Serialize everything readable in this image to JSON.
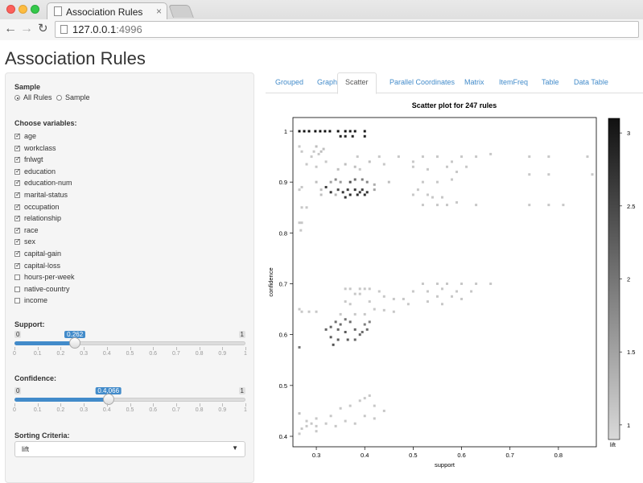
{
  "browser": {
    "tab_title": "Association Rules",
    "tab_close": "×",
    "url_host": "127.0.0.1",
    "url_port": ":4996",
    "back_glyph": "←",
    "forward_glyph": "→",
    "reload_glyph": "↻"
  },
  "page": {
    "title": "Association Rules"
  },
  "sidebar": {
    "sample_label": "Sample",
    "sample_options": [
      {
        "label": "All Rules",
        "checked": true
      },
      {
        "label": "Sample",
        "checked": false
      }
    ],
    "choose_label": "Choose variables:",
    "variables": [
      {
        "label": "age",
        "checked": true
      },
      {
        "label": "workclass",
        "checked": true
      },
      {
        "label": "fnlwgt",
        "checked": true
      },
      {
        "label": "education",
        "checked": true
      },
      {
        "label": "education-num",
        "checked": true
      },
      {
        "label": "marital-status",
        "checked": true
      },
      {
        "label": "occupation",
        "checked": true
      },
      {
        "label": "relationship",
        "checked": true
      },
      {
        "label": "race",
        "checked": true
      },
      {
        "label": "sex",
        "checked": true
      },
      {
        "label": "capital-gain",
        "checked": true
      },
      {
        "label": "capital-loss",
        "checked": true
      },
      {
        "label": "hours-per-week",
        "checked": false
      },
      {
        "label": "native-country",
        "checked": false
      },
      {
        "label": "income",
        "checked": false
      }
    ],
    "support": {
      "label": "Support:",
      "min_label": "0",
      "max_label": "1",
      "value_label": "0.262",
      "value": 0.262
    },
    "confidence": {
      "label": "Confidence:",
      "min_label": "0",
      "max_label": "1",
      "value_label": "0.4,066",
      "value": 0.4066
    },
    "slider_ticks": [
      "0",
      "0.1",
      "0.2",
      "0.3",
      "0.4",
      "0.5",
      "0.6",
      "0.7",
      "0.8",
      "0.9",
      "1"
    ],
    "sorting": {
      "label": "Sorting Criteria:",
      "value": "lift",
      "caret": "▼"
    }
  },
  "tabs": [
    {
      "label": "Grouped",
      "active": false
    },
    {
      "label": "Graph",
      "active": false
    },
    {
      "label": "Scatter",
      "active": true
    },
    {
      "label": "Parallel Coordinates",
      "active": false
    },
    {
      "label": "Matrix",
      "active": false
    },
    {
      "label": "ItemFreq",
      "active": false
    },
    {
      "label": "Table",
      "active": false
    },
    {
      "label": "Data Table",
      "active": false
    }
  ],
  "plot": {
    "title": "Scatter plot for 247 rules"
  },
  "chart_data": {
    "type": "scatter",
    "title": "Scatter plot for 247 rules",
    "xlabel": "support",
    "ylabel": "confidence",
    "xlim": [
      0.26,
      0.87
    ],
    "ylim": [
      0.4,
      1.0
    ],
    "xticks": [
      "0.3",
      "0.4",
      "0.5",
      "0.6",
      "0.7",
      "0.8"
    ],
    "xtick_values": [
      0.3,
      0.4,
      0.5,
      0.6,
      0.7,
      0.8
    ],
    "yticks": [
      "0.4",
      "0.5",
      "0.6",
      "0.7",
      "0.8",
      "0.9",
      "1"
    ],
    "ytick_values": [
      0.4,
      0.5,
      0.6,
      0.7,
      0.8,
      0.9,
      1.0
    ],
    "colorbar": {
      "label": "lift",
      "ticks": [
        "1",
        "1.5",
        "2",
        "2.5",
        "3"
      ],
      "tick_values": [
        1,
        1.5,
        2,
        2.5,
        3
      ],
      "range": [
        0.9,
        3.1
      ],
      "low_color": "#d9d9d9",
      "high_color": "#111111"
    },
    "points": [
      [
        0.265,
        1.0,
        3.1
      ],
      [
        0.275,
        1.0,
        3.1
      ],
      [
        0.285,
        1.0,
        3.1
      ],
      [
        0.298,
        1.0,
        3.1
      ],
      [
        0.308,
        1.0,
        3.1
      ],
      [
        0.318,
        1.0,
        3.1
      ],
      [
        0.328,
        1.0,
        3.1
      ],
      [
        0.345,
        1.0,
        3.1
      ],
      [
        0.36,
        1.0,
        3.1
      ],
      [
        0.37,
        1.0,
        3.0
      ],
      [
        0.38,
        1.0,
        3.0
      ],
      [
        0.4,
        1.0,
        3.0
      ],
      [
        0.35,
        0.99,
        2.9
      ],
      [
        0.36,
        0.99,
        2.9
      ],
      [
        0.375,
        0.99,
        2.9
      ],
      [
        0.4,
        0.99,
        2.9
      ],
      [
        0.265,
        0.97,
        1.1
      ],
      [
        0.27,
        0.96,
        1.1
      ],
      [
        0.3,
        0.97,
        1.2
      ],
      [
        0.31,
        0.96,
        1.2
      ],
      [
        0.315,
        0.965,
        1.2
      ],
      [
        0.305,
        0.955,
        1.1
      ],
      [
        0.295,
        0.96,
        1.1
      ],
      [
        0.29,
        0.95,
        1.1
      ],
      [
        0.32,
        0.94,
        1.1
      ],
      [
        0.385,
        0.95,
        1.1
      ],
      [
        0.41,
        0.94,
        1.2
      ],
      [
        0.43,
        0.95,
        1.1
      ],
      [
        0.47,
        0.95,
        1.1
      ],
      [
        0.5,
        0.94,
        1.1
      ],
      [
        0.52,
        0.95,
        1.1
      ],
      [
        0.55,
        0.95,
        1.1
      ],
      [
        0.58,
        0.94,
        1.1
      ],
      [
        0.6,
        0.95,
        1.1
      ],
      [
        0.63,
        0.95,
        1.1
      ],
      [
        0.66,
        0.955,
        1.1
      ],
      [
        0.74,
        0.95,
        1.1
      ],
      [
        0.78,
        0.95,
        1.1
      ],
      [
        0.86,
        0.95,
        1.1
      ],
      [
        0.28,
        0.935,
        1.1
      ],
      [
        0.3,
        0.93,
        1.1
      ],
      [
        0.345,
        0.925,
        1.2
      ],
      [
        0.36,
        0.935,
        1.2
      ],
      [
        0.38,
        0.93,
        1.2
      ],
      [
        0.39,
        0.925,
        1.1
      ],
      [
        0.44,
        0.935,
        1.1
      ],
      [
        0.5,
        0.93,
        1.1
      ],
      [
        0.53,
        0.925,
        1.1
      ],
      [
        0.57,
        0.93,
        1.1
      ],
      [
        0.59,
        0.92,
        1.1
      ],
      [
        0.61,
        0.93,
        1.1
      ],
      [
        0.87,
        0.915,
        1.1
      ],
      [
        0.74,
        0.915,
        1.1
      ],
      [
        0.78,
        0.915,
        1.1
      ],
      [
        0.27,
        0.89,
        1.1
      ],
      [
        0.265,
        0.885,
        1.1
      ],
      [
        0.3,
        0.9,
        1.2
      ],
      [
        0.33,
        0.9,
        1.5
      ],
      [
        0.34,
        0.905,
        1.8
      ],
      [
        0.35,
        0.9,
        1.6
      ],
      [
        0.37,
        0.9,
        2.4
      ],
      [
        0.38,
        0.905,
        2.1
      ],
      [
        0.395,
        0.905,
        1.9
      ],
      [
        0.405,
        0.9,
        1.8
      ],
      [
        0.42,
        0.895,
        1.4
      ],
      [
        0.45,
        0.9,
        1.2
      ],
      [
        0.52,
        0.9,
        1.1
      ],
      [
        0.55,
        0.9,
        1.1
      ],
      [
        0.58,
        0.905,
        1.1
      ],
      [
        0.31,
        0.885,
        1.2
      ],
      [
        0.32,
        0.89,
        2.6
      ],
      [
        0.33,
        0.88,
        2.7
      ],
      [
        0.345,
        0.885,
        2.5
      ],
      [
        0.355,
        0.88,
        2.7
      ],
      [
        0.365,
        0.885,
        2.6
      ],
      [
        0.37,
        0.875,
        2.8
      ],
      [
        0.38,
        0.885,
        2.7
      ],
      [
        0.39,
        0.88,
        2.7
      ],
      [
        0.395,
        0.885,
        2.6
      ],
      [
        0.4,
        0.875,
        2.8
      ],
      [
        0.405,
        0.88,
        2.7
      ],
      [
        0.42,
        0.885,
        1.5
      ],
      [
        0.31,
        0.875,
        1.2
      ],
      [
        0.34,
        0.875,
        1.3
      ],
      [
        0.36,
        0.87,
        2.7
      ],
      [
        0.385,
        0.875,
        2.8
      ],
      [
        0.5,
        0.875,
        1.1
      ],
      [
        0.51,
        0.885,
        1.1
      ],
      [
        0.53,
        0.875,
        1.1
      ],
      [
        0.54,
        0.87,
        1.1
      ],
      [
        0.56,
        0.87,
        1.1
      ],
      [
        0.27,
        0.85,
        1.1
      ],
      [
        0.28,
        0.85,
        1.1
      ],
      [
        0.52,
        0.855,
        1.1
      ],
      [
        0.55,
        0.855,
        1.1
      ],
      [
        0.57,
        0.855,
        1.1
      ],
      [
        0.59,
        0.86,
        1.1
      ],
      [
        0.63,
        0.855,
        1.1
      ],
      [
        0.74,
        0.855,
        1.1
      ],
      [
        0.78,
        0.855,
        1.1
      ],
      [
        0.81,
        0.855,
        1.1
      ],
      [
        0.265,
        0.82,
        1.1
      ],
      [
        0.27,
        0.82,
        1.1
      ],
      [
        0.268,
        0.805,
        1.1
      ],
      [
        0.52,
        0.7,
        1.1
      ],
      [
        0.55,
        0.7,
        1.1
      ],
      [
        0.57,
        0.7,
        1.1
      ],
      [
        0.6,
        0.7,
        1.1
      ],
      [
        0.63,
        0.7,
        1.1
      ],
      [
        0.66,
        0.7,
        1.1
      ],
      [
        0.36,
        0.69,
        1.1
      ],
      [
        0.37,
        0.69,
        1.1
      ],
      [
        0.39,
        0.69,
        1.1
      ],
      [
        0.4,
        0.69,
        1.1
      ],
      [
        0.41,
        0.69,
        1.1
      ],
      [
        0.43,
        0.685,
        1.1
      ],
      [
        0.5,
        0.685,
        1.1
      ],
      [
        0.53,
        0.685,
        1.1
      ],
      [
        0.56,
        0.69,
        1.1
      ],
      [
        0.59,
        0.685,
        1.1
      ],
      [
        0.62,
        0.685,
        1.1
      ],
      [
        0.38,
        0.68,
        1.1
      ],
      [
        0.39,
        0.68,
        1.1
      ],
      [
        0.44,
        0.675,
        1.1
      ],
      [
        0.46,
        0.67,
        1.1
      ],
      [
        0.48,
        0.67,
        1.1
      ],
      [
        0.55,
        0.675,
        1.1
      ],
      [
        0.58,
        0.675,
        1.1
      ],
      [
        0.6,
        0.67,
        1.1
      ],
      [
        0.36,
        0.665,
        1.1
      ],
      [
        0.37,
        0.66,
        1.1
      ],
      [
        0.41,
        0.665,
        1.1
      ],
      [
        0.49,
        0.66,
        1.1
      ],
      [
        0.53,
        0.665,
        1.1
      ],
      [
        0.56,
        0.66,
        1.1
      ],
      [
        0.265,
        0.65,
        1.1
      ],
      [
        0.27,
        0.645,
        1.1
      ],
      [
        0.285,
        0.645,
        1.1
      ],
      [
        0.3,
        0.645,
        1.1
      ],
      [
        0.42,
        0.65,
        1.1
      ],
      [
        0.44,
        0.648,
        1.1
      ],
      [
        0.46,
        0.645,
        1.1
      ],
      [
        0.35,
        0.64,
        1.1
      ],
      [
        0.38,
        0.64,
        1.1
      ],
      [
        0.4,
        0.64,
        1.1
      ],
      [
        0.34,
        0.625,
        2.1
      ],
      [
        0.35,
        0.62,
        2.1
      ],
      [
        0.36,
        0.63,
        2.0
      ],
      [
        0.37,
        0.625,
        2.1
      ],
      [
        0.4,
        0.62,
        1.9
      ],
      [
        0.41,
        0.625,
        1.9
      ],
      [
        0.32,
        0.61,
        2.2
      ],
      [
        0.33,
        0.615,
        2.2
      ],
      [
        0.345,
        0.61,
        2.2
      ],
      [
        0.36,
        0.605,
        2.3
      ],
      [
        0.38,
        0.61,
        2.2
      ],
      [
        0.395,
        0.605,
        2.1
      ],
      [
        0.405,
        0.61,
        2.1
      ],
      [
        0.33,
        0.595,
        2.3
      ],
      [
        0.345,
        0.59,
        2.3
      ],
      [
        0.365,
        0.59,
        2.3
      ],
      [
        0.38,
        0.59,
        2.2
      ],
      [
        0.39,
        0.6,
        2.2
      ],
      [
        0.335,
        0.58,
        2.4
      ],
      [
        0.265,
        0.575,
        2.0
      ],
      [
        0.265,
        0.445,
        1.2
      ],
      [
        0.28,
        0.43,
        1.1
      ],
      [
        0.3,
        0.435,
        1.1
      ],
      [
        0.33,
        0.44,
        1.1
      ],
      [
        0.35,
        0.455,
        1.1
      ],
      [
        0.37,
        0.46,
        1.1
      ],
      [
        0.39,
        0.47,
        1.1
      ],
      [
        0.4,
        0.475,
        1.1
      ],
      [
        0.41,
        0.48,
        1.1
      ],
      [
        0.42,
        0.46,
        1.1
      ],
      [
        0.44,
        0.45,
        1.1
      ],
      [
        0.27,
        0.415,
        1.1
      ],
      [
        0.28,
        0.42,
        1.1
      ],
      [
        0.29,
        0.425,
        1.1
      ],
      [
        0.3,
        0.42,
        1.1
      ],
      [
        0.32,
        0.425,
        1.1
      ],
      [
        0.34,
        0.42,
        1.1
      ],
      [
        0.36,
        0.43,
        1.1
      ],
      [
        0.38,
        0.425,
        1.1
      ],
      [
        0.4,
        0.44,
        1.1
      ],
      [
        0.42,
        0.435,
        1.1
      ],
      [
        0.265,
        0.405,
        1.1
      ],
      [
        0.3,
        0.41,
        1.1
      ]
    ]
  }
}
